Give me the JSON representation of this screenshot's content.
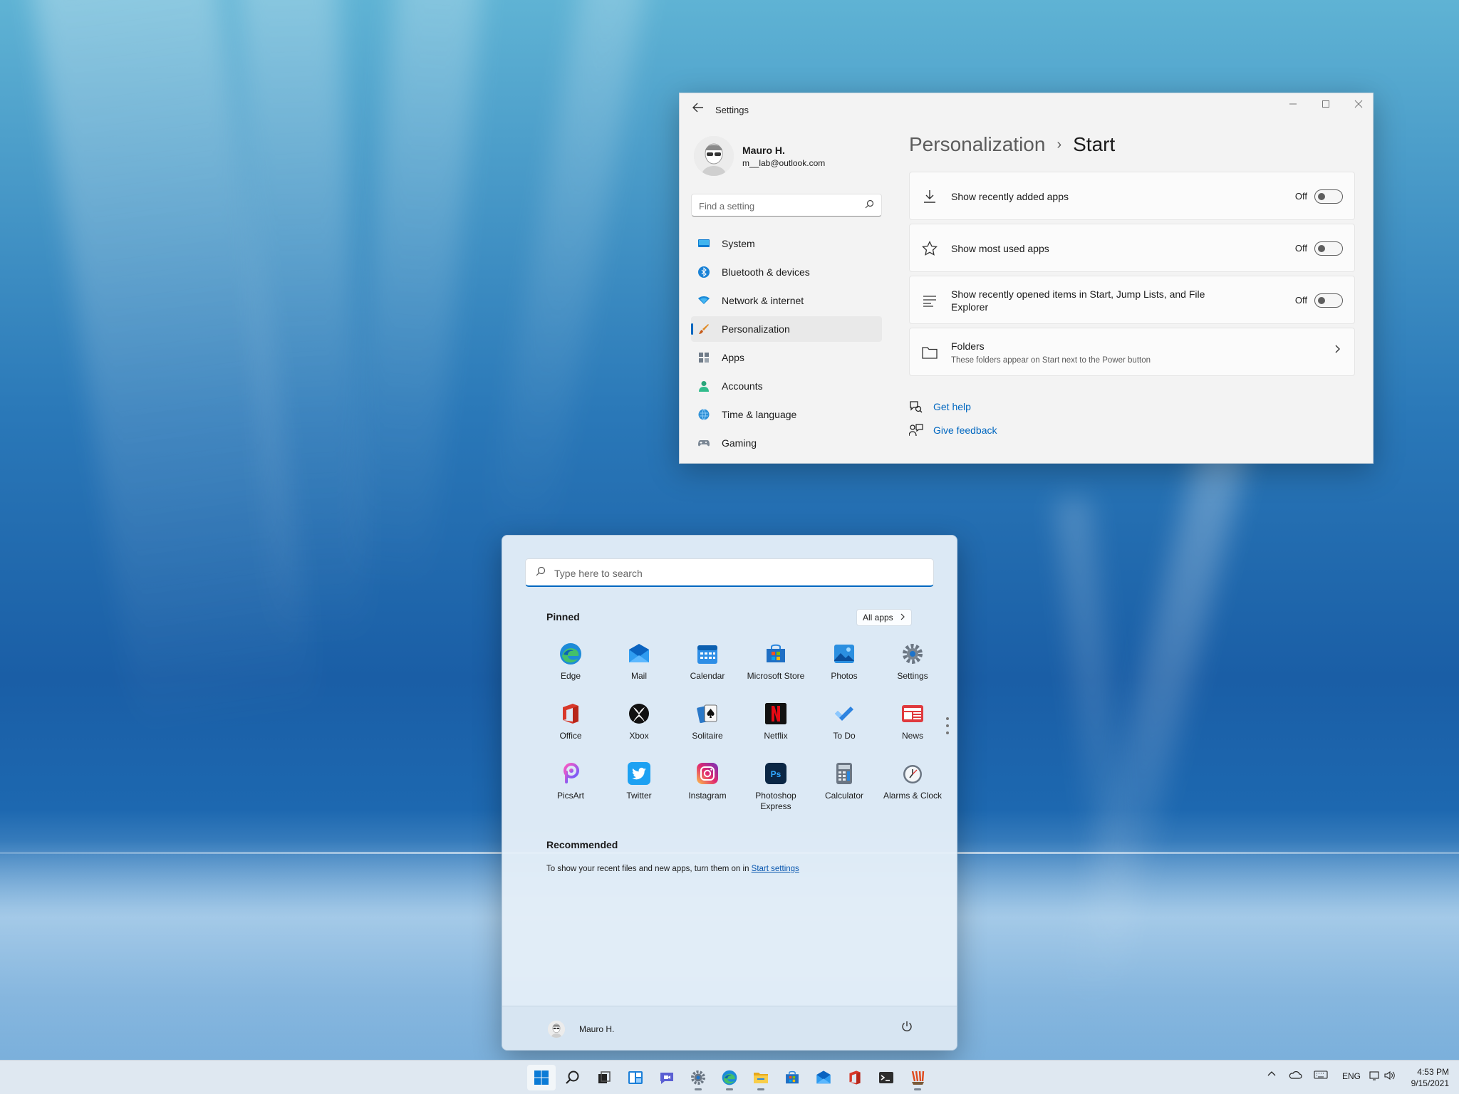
{
  "settings": {
    "title": "Settings",
    "profile": {
      "name": "Mauro H.",
      "email": "m__lab@outlook.com"
    },
    "search": {
      "placeholder": "Find a setting"
    },
    "nav": [
      {
        "label": "System",
        "icon": "monitor-icon"
      },
      {
        "label": "Bluetooth & devices",
        "icon": "bluetooth-icon"
      },
      {
        "label": "Network & internet",
        "icon": "wifi-icon"
      },
      {
        "label": "Personalization",
        "icon": "brush-icon",
        "active": true
      },
      {
        "label": "Apps",
        "icon": "apps-icon"
      },
      {
        "label": "Accounts",
        "icon": "person-icon"
      },
      {
        "label": "Time & language",
        "icon": "globe-clock-icon"
      },
      {
        "label": "Gaming",
        "icon": "gamepad-icon"
      }
    ],
    "breadcrumb": {
      "parent": "Personalization",
      "separator": "›",
      "current": "Start"
    },
    "options": [
      {
        "label": "Show recently added apps",
        "state": "Off",
        "icon": "download-icon"
      },
      {
        "label": "Show most used apps",
        "state": "Off",
        "icon": "star-icon"
      },
      {
        "label": "Show recently opened items in Start, Jump Lists, and File Explorer",
        "state": "Off",
        "icon": "list-icon"
      }
    ],
    "folders": {
      "label": "Folders",
      "description": "These folders appear on Start next to the Power button",
      "icon": "folder-icon"
    },
    "links": {
      "help": "Get help",
      "feedback": "Give feedback"
    }
  },
  "start": {
    "search_placeholder": "Type here to search",
    "pinned_title": "Pinned",
    "all_apps": "All apps",
    "pinned": [
      {
        "label": "Edge",
        "icon": "edge-icon"
      },
      {
        "label": "Mail",
        "icon": "mail-icon"
      },
      {
        "label": "Calendar",
        "icon": "calendar-icon"
      },
      {
        "label": "Microsoft Store",
        "icon": "store-icon"
      },
      {
        "label": "Photos",
        "icon": "photos-icon"
      },
      {
        "label": "Settings",
        "icon": "gear-icon"
      },
      {
        "label": "Office",
        "icon": "office-icon"
      },
      {
        "label": "Xbox",
        "icon": "xbox-icon"
      },
      {
        "label": "Solitaire",
        "icon": "cards-icon"
      },
      {
        "label": "Netflix",
        "icon": "netflix-icon"
      },
      {
        "label": "To Do",
        "icon": "check-icon"
      },
      {
        "label": "News",
        "icon": "news-icon"
      },
      {
        "label": "PicsArt",
        "icon": "picsart-icon"
      },
      {
        "label": "Twitter",
        "icon": "twitter-icon"
      },
      {
        "label": "Instagram",
        "icon": "instagram-icon"
      },
      {
        "label": "Photoshop Express",
        "icon": "photoshop-icon"
      },
      {
        "label": "Calculator",
        "icon": "calculator-icon"
      },
      {
        "label": "Alarms & Clock",
        "icon": "clock-icon"
      }
    ],
    "recommended_title": "Recommended",
    "recommended_text": "To show your recent files and new apps, turn them on in ",
    "recommended_link": "Start settings",
    "user": "Mauro H."
  },
  "taskbar": {
    "apps": [
      "start-icon",
      "search-icon",
      "task-view-icon",
      "widgets-icon",
      "chat-icon",
      "settings-icon",
      "edge-icon",
      "file-explorer-icon",
      "store-icon",
      "mail-icon",
      "office-icon",
      "terminal-icon",
      "paint-icon"
    ],
    "language": "ENG",
    "time": "4:53 PM",
    "date": "9/15/2021"
  },
  "colors": {
    "accent": "#0067c0"
  }
}
